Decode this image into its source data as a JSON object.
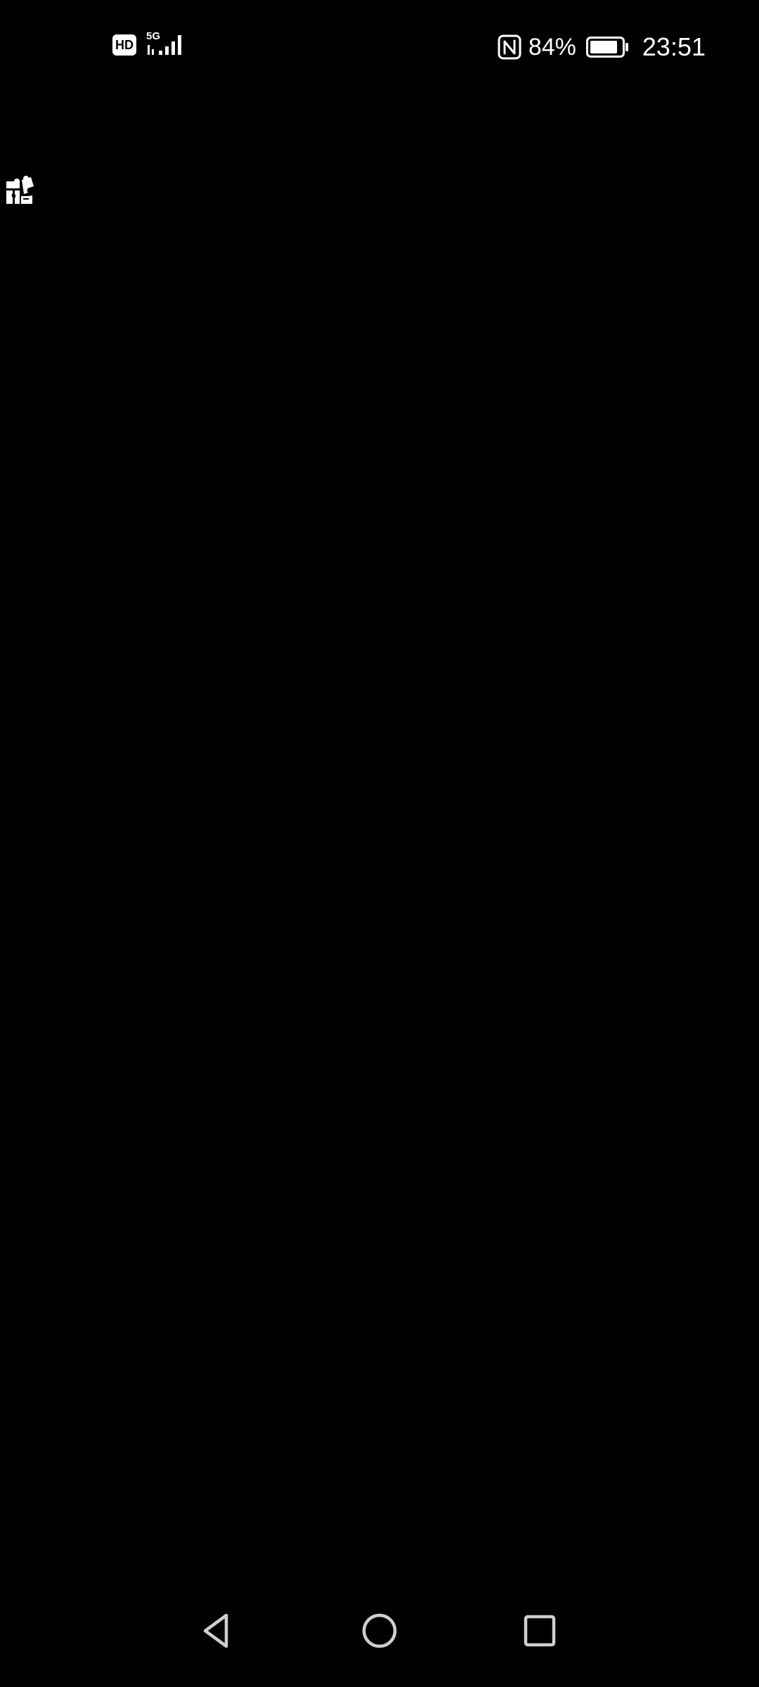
{
  "status_bar": {
    "hd_label": "HD",
    "network_type": "5G",
    "signal_icon": "cellular-signal-icon",
    "nfc_icon": "nfc-icon",
    "battery_percent": "84%",
    "battery_icon": "battery-icon",
    "time": "23:51"
  },
  "floating": {
    "icon": "puzzle-extension-icon"
  },
  "navigation": {
    "back_icon": "back-triangle-icon",
    "home_icon": "home-circle-icon",
    "recents_icon": "recents-square-icon"
  },
  "colors": {
    "background": "#000000",
    "foreground": "#ffffff",
    "nav_icon": "#cfcfcf"
  }
}
